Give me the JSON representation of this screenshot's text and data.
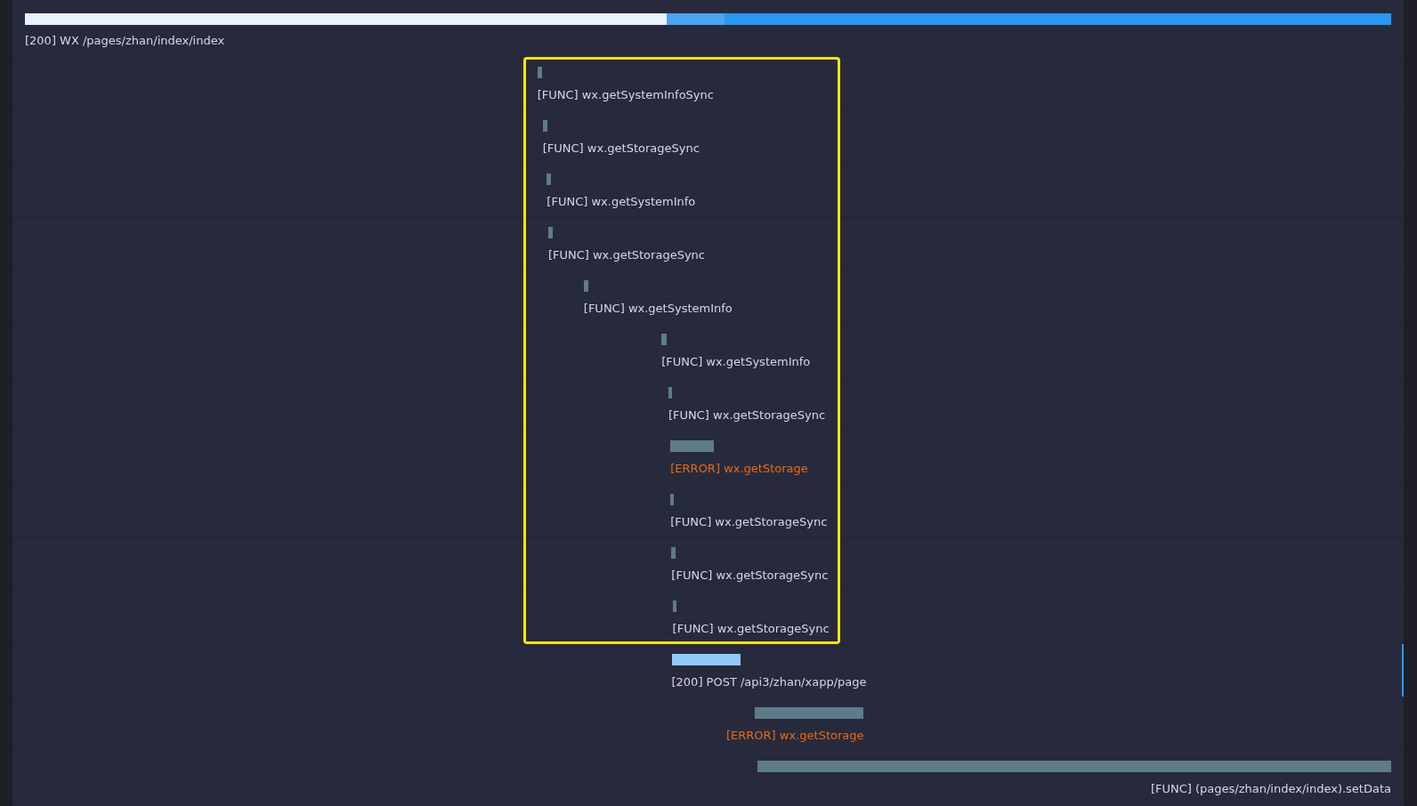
{
  "trace": {
    "rows": [
      {
        "label": "[200] WX /pages/zhan/index/index",
        "kind": "page",
        "selected": false,
        "highlighted": false
      },
      {
        "label": "[FUNC] wx.getSystemInfoSync",
        "kind": "func",
        "selected": false,
        "highlighted": true
      },
      {
        "label": "[FUNC] wx.getStorageSync",
        "kind": "func",
        "selected": false,
        "highlighted": true
      },
      {
        "label": "[FUNC] wx.getSystemInfo",
        "kind": "func",
        "selected": false,
        "highlighted": true
      },
      {
        "label": "[FUNC] wx.getStorageSync",
        "kind": "func",
        "selected": false,
        "highlighted": true
      },
      {
        "label": "[FUNC] wx.getSystemInfo",
        "kind": "func",
        "selected": false,
        "highlighted": true
      },
      {
        "label": "[FUNC] wx.getSystemInfo",
        "kind": "func",
        "selected": false,
        "highlighted": true
      },
      {
        "label": "[FUNC] wx.getStorageSync",
        "kind": "func",
        "selected": false,
        "highlighted": true
      },
      {
        "label": "[ERROR] wx.getStorage",
        "kind": "error",
        "selected": false,
        "highlighted": true
      },
      {
        "label": "[FUNC] wx.getStorageSync",
        "kind": "func",
        "selected": false,
        "highlighted": true
      },
      {
        "label": "[FUNC] wx.getStorageSync",
        "kind": "func",
        "selected": false,
        "highlighted": true
      },
      {
        "label": "[FUNC] wx.getStorageSync",
        "kind": "func",
        "selected": false,
        "highlighted": true
      },
      {
        "label": "[200] POST /api3/zhan/xapp/page",
        "kind": "request",
        "selected": true,
        "highlighted": false
      },
      {
        "label": "[ERROR] wx.getStorage",
        "kind": "error",
        "selected": false,
        "highlighted": false
      },
      {
        "label": "[FUNC] (pages/zhan/index/index).setData",
        "kind": "func",
        "selected": false,
        "highlighted": false
      }
    ]
  }
}
